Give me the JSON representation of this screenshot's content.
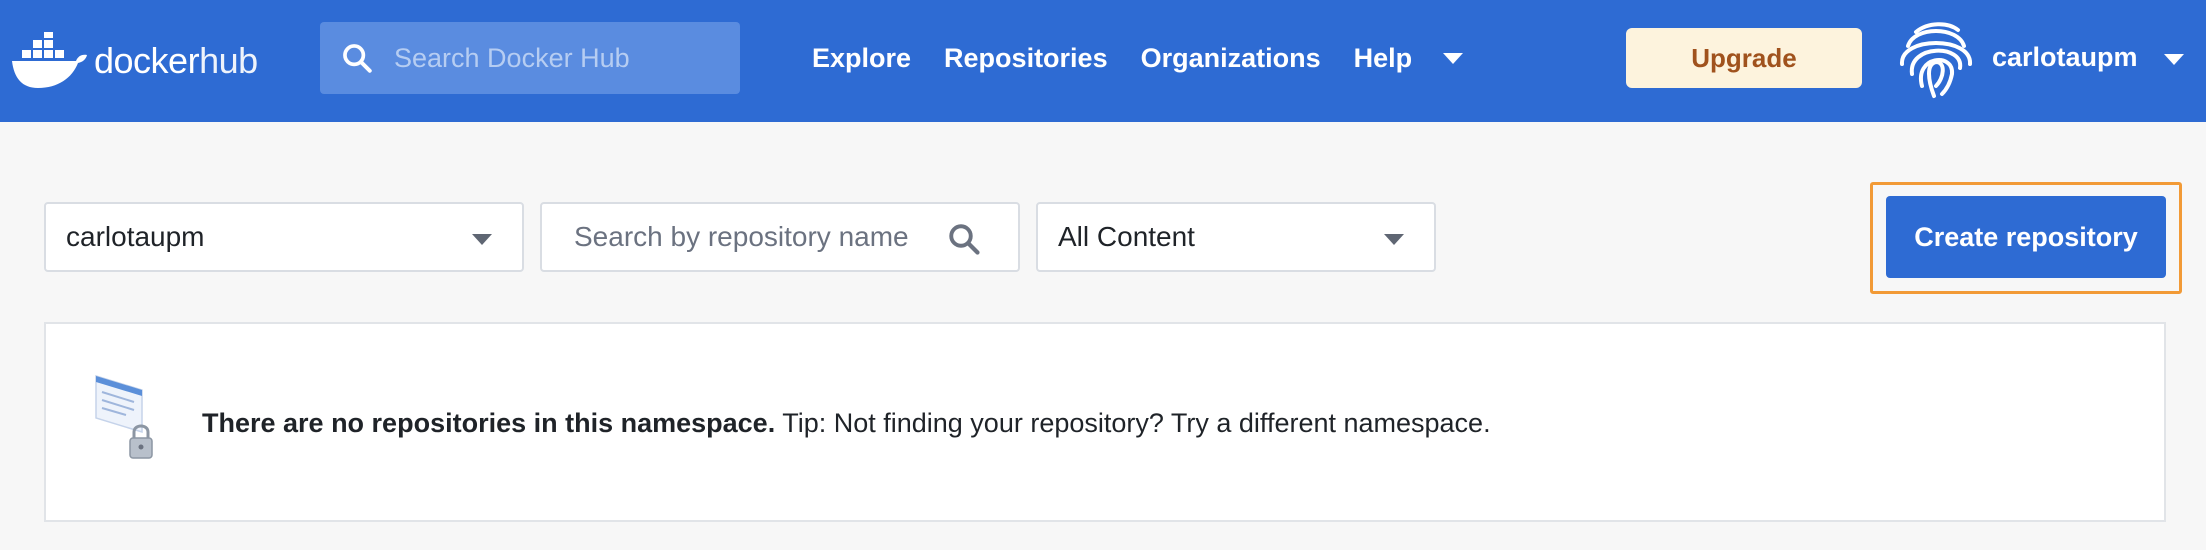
{
  "header": {
    "logo_text_bold": "docker",
    "logo_text_light": "hub",
    "search_placeholder": "Search Docker Hub",
    "nav": [
      "Explore",
      "Repositories",
      "Organizations",
      "Help"
    ],
    "upgrade_label": "Upgrade",
    "username": "carlotaupm"
  },
  "toolbar": {
    "namespace_value": "carlotaupm",
    "repo_search_placeholder": "Search by repository name",
    "content_filter_value": "All Content",
    "create_label": "Create repository"
  },
  "empty_state": {
    "message_bold": "There are no repositories in this namespace.",
    "message_tip": " Tip: Not finding your repository? Try a different namespace."
  },
  "colors": {
    "header_bg": "#2e6bd3",
    "upgrade_bg": "#fdf3dd",
    "upgrade_text": "#a0521d",
    "create_highlight": "#f29a36"
  }
}
